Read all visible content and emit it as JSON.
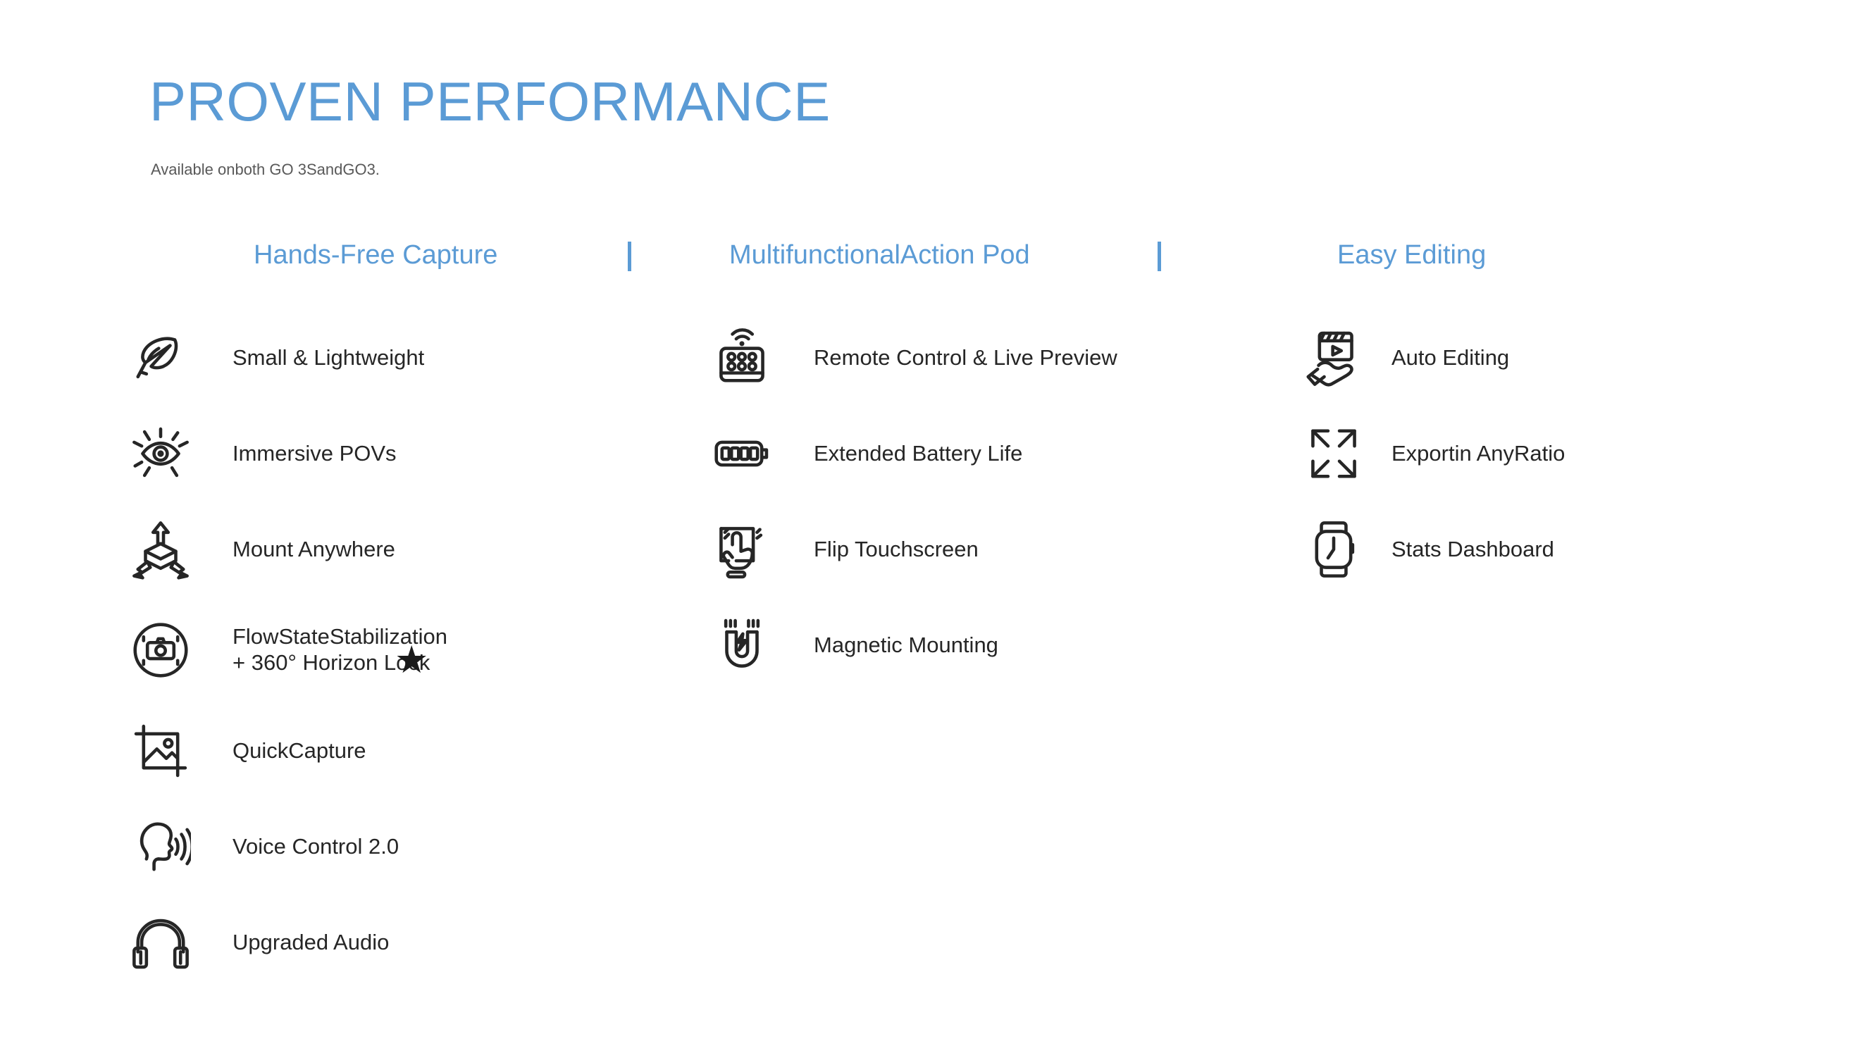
{
  "header": {
    "title": "PROVEN PERFORMANCE",
    "subtitle": "Available onboth GO 3SandGO3.",
    "title_color": "#5B9BD5",
    "body_color": "#262626"
  },
  "columns": [
    {
      "header": "Hands-Free Capture",
      "features": [
        {
          "icon": "feather-icon",
          "label": "Small & Lightweight"
        },
        {
          "icon": "eye-icon",
          "label": "Immersive POVs"
        },
        {
          "icon": "mount-arrows-icon",
          "label": "Mount Anywhere"
        },
        {
          "icon": "stabilization-camera-icon",
          "label": "FlowStateStabilization\n+ 360° Horizon Lock",
          "badge": "★"
        },
        {
          "icon": "quick-capture-image-icon",
          "label": "QuickCapture"
        },
        {
          "icon": "voice-control-icon",
          "label": "Voice Control 2.0"
        },
        {
          "icon": "headphones-icon",
          "label": "Upgraded Audio"
        }
      ]
    },
    {
      "header": "MultifunctionalAction Pod",
      "features": [
        {
          "icon": "remote-control-icon",
          "label": "Remote Control & Live Preview"
        },
        {
          "icon": "battery-icon",
          "label": "Extended Battery Life"
        },
        {
          "icon": "touchscreen-icon",
          "label": "Flip Touchscreen"
        },
        {
          "icon": "magnet-icon",
          "label": "Magnetic Mounting"
        }
      ]
    },
    {
      "header": "Easy Editing",
      "features": [
        {
          "icon": "auto-editing-hand-icon",
          "label": "Auto Editing"
        },
        {
          "icon": "expand-arrows-icon",
          "label": "Exportin AnyRatio"
        },
        {
          "icon": "smartwatch-icon",
          "label": "Stats Dashboard"
        }
      ]
    }
  ],
  "separators": [
    "l",
    "l"
  ]
}
